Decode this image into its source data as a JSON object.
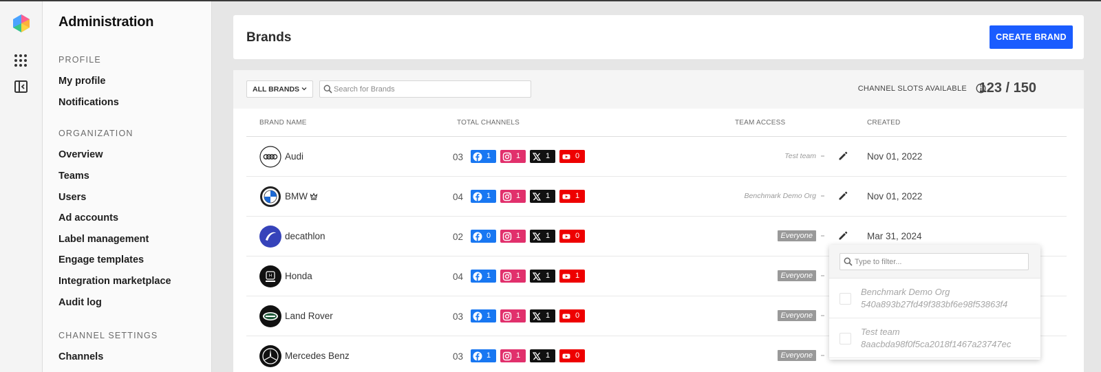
{
  "sidebar": {
    "title": "Administration",
    "sections": {
      "profile": "PROFILE",
      "organization": "ORGANIZATION",
      "channel_settings": "CHANNEL SETTINGS"
    },
    "items": {
      "my_profile": "My profile",
      "notifications": "Notifications",
      "overview": "Overview",
      "teams": "Teams",
      "users": "Users",
      "ad_accounts": "Ad accounts",
      "label_management": "Label management",
      "engage_templates": "Engage templates",
      "integration_marketplace": "Integration marketplace",
      "audit_log": "Audit log",
      "channels": "Channels"
    }
  },
  "header": {
    "title": "Brands",
    "create_label": "CREATE BRAND"
  },
  "toolbar": {
    "filter_label": "ALL BRANDS",
    "search_placeholder": "Search for Brands",
    "slots_label": "CHANNEL SLOTS AVAILABLE",
    "slots_value": "123 / 150"
  },
  "columns": {
    "brand_name": "BRAND NAME",
    "total_channels": "TOTAL CHANNELS",
    "team_access": "TEAM ACCESS",
    "created": "CREATED"
  },
  "rows": [
    {
      "name": "Audi",
      "total": "03",
      "fb": "1",
      "ig": "1",
      "x": "1",
      "yt": "0",
      "team": "Test team",
      "created": "Nov 01, 2022"
    },
    {
      "name": "BMW",
      "total": "04",
      "fb": "1",
      "ig": "1",
      "x": "1",
      "yt": "1",
      "team": "Benchmark Demo Org",
      "created": "Nov 01, 2022"
    },
    {
      "name": "decathlon",
      "total": "02",
      "fb": "0",
      "ig": "1",
      "x": "1",
      "yt": "0",
      "team": "Everyone",
      "created": "Mar 31, 2024"
    },
    {
      "name": "Honda",
      "total": "04",
      "fb": "1",
      "ig": "1",
      "x": "1",
      "yt": "1",
      "team": "Everyone",
      "created": ""
    },
    {
      "name": "Land Rover",
      "total": "03",
      "fb": "1",
      "ig": "1",
      "x": "1",
      "yt": "0",
      "team": "Everyone",
      "created": ""
    },
    {
      "name": "Mercedes Benz",
      "total": "03",
      "fb": "1",
      "ig": "1",
      "x": "1",
      "yt": "0",
      "team": "Everyone",
      "created": ""
    }
  ],
  "dropdown": {
    "filter_placeholder": "Type to filter...",
    "options": [
      {
        "name": "Benchmark Demo Org",
        "id": "540a893b27fd49f383bf6e98f53863f4"
      },
      {
        "name": "Test team",
        "id": "8aacbda98f0f5ca2018f1467a23747ec"
      }
    ]
  },
  "colors": {
    "accent": "#1a5cff",
    "facebook": "#1877f2",
    "instagram": "#e1306c",
    "x": "#111111",
    "youtube": "#ee0000"
  }
}
